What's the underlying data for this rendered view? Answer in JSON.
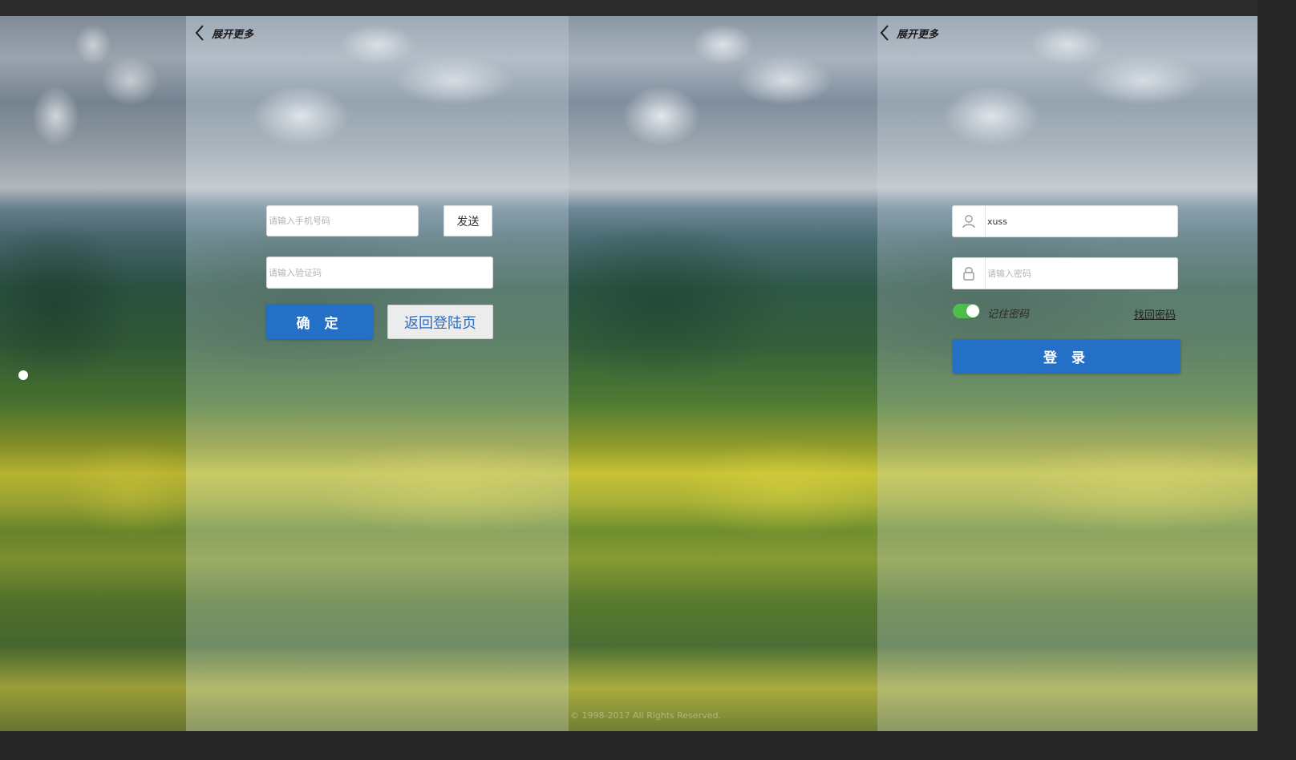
{
  "panel_left": {
    "back_label": "展开更多",
    "phone_placeholder": "请输入手机号码",
    "send_label": "发送",
    "code_placeholder": "请输入验证码",
    "confirm_label": "确 定",
    "return_label": "返回登陆页"
  },
  "panel_right": {
    "back_label": "展开更多",
    "username_value": "xuss",
    "password_placeholder": "请输入密码",
    "remember_label": "记住密码",
    "remember_on": true,
    "forgot_label": "找回密码",
    "login_label": "登 录"
  },
  "footer": {
    "copyright": "© 1998-2017 All Rights Reserved."
  },
  "colors": {
    "primary_button": "#2470c7",
    "toggle_on": "#4cbf4a",
    "return_text": "#2a6fc3"
  },
  "icons": [
    "chevron-left-icon",
    "user-icon",
    "lock-icon"
  ]
}
